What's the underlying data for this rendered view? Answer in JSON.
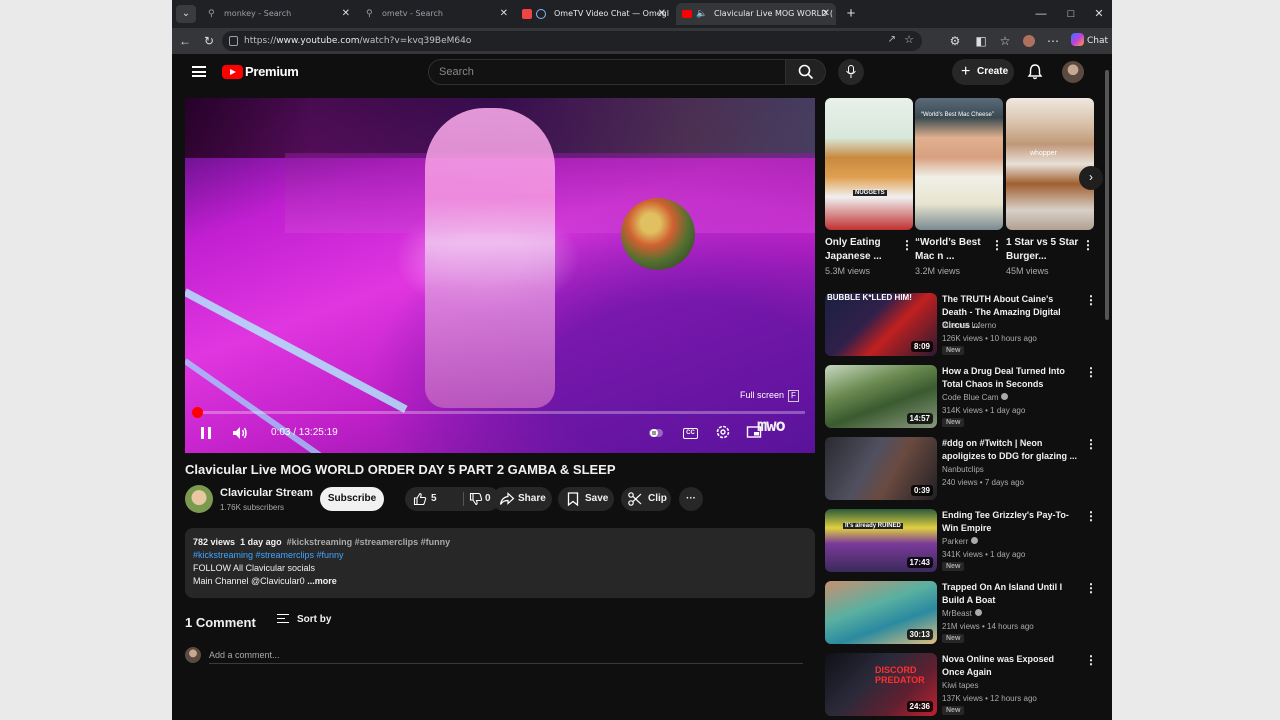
{
  "browser": {
    "tabs": [
      {
        "label": "monkey - Search",
        "active": false
      },
      {
        "label": "ometv - Search",
        "active": false
      },
      {
        "label": "OmeTV Video Chat — Omegl",
        "active": false
      },
      {
        "label": "Clavicular Live MOG WORLD (",
        "active": true
      }
    ],
    "url_prefix": "https://",
    "url_host": "www.youtube.com",
    "url_path": "/watch?v=kvq39BeM64o",
    "chat_label": "Chat"
  },
  "header": {
    "logo_text": "Premium",
    "search_placeholder": "Search",
    "create_label": "Create"
  },
  "player": {
    "time": "0:03 / 13:25:19",
    "progress": 0.0004,
    "fullscreen_tip": "Full screen",
    "fullscreen_key": "F",
    "watermark": "mwo"
  },
  "video": {
    "title": "Clavicular Live MOG WORLD ORDER DAY 5 PART 2 GAMBA & SLEEP",
    "channel": "Clavicular Stream",
    "subscribers": "1.76K subscribers",
    "subscribe_label": "Subscribe",
    "likes": "5",
    "dislikes": "0",
    "share_label": "Share",
    "save_label": "Save",
    "clip_label": "Clip"
  },
  "description": {
    "views": "782 views",
    "age": "1 day ago",
    "tags_line1": "#kickstreaming #streamerclips #funny",
    "tags_line2": "#kickstreaming #streamerclips #funny",
    "line3": "FOLLOW All Clavicular socials",
    "line4": "Main Channel @Clavicular0",
    "more": "...more"
  },
  "comments": {
    "count_label": "1 Comment",
    "sort_label": "Sort by",
    "add_placeholder": "Add a comment..."
  },
  "shorts": [
    {
      "title": "Only Eating Japanese ...",
      "views": "5.3M views",
      "overlay": "NUGGETS"
    },
    {
      "title": "“World’s Best Mac n ...",
      "views": "3.2M views",
      "overlay": "“World’s Best Mac Cheese”"
    },
    {
      "title": "1 Star vs 5 Star Burger...",
      "views": "45M views",
      "overlay": "whopper"
    }
  ],
  "related": [
    {
      "title": "The TRUTH About Caine's Death - The Amazing Digital Circus ...",
      "channel": "Internet Inferno",
      "meta": "126K views • 10 hours ago",
      "badge": "New",
      "duration": "8:09",
      "thumb_text": "BUBBLE K*LLED HIM!",
      "verified": false
    },
    {
      "title": "How a Drug Deal Turned Into Total Chaos in Seconds",
      "channel": "Code Blue Cam",
      "meta": "314K views • 1 day ago",
      "badge": "New",
      "duration": "14:57",
      "thumb_text": "",
      "verified": true
    },
    {
      "title": "#ddg on #Twitch | Neon apoligizes to DDG for glazing ...",
      "channel": "Nanbutclips",
      "meta": "240 views • 7 days ago",
      "badge": "",
      "duration": "0:39",
      "thumb_text": "",
      "verified": false
    },
    {
      "title": "Ending Tee Grizzley's Pay-To-Win Empire",
      "channel": "Parkerr",
      "meta": "341K views • 1 day ago",
      "badge": "New",
      "duration": "17:43",
      "thumb_text": "It's already RUINED",
      "verified": true
    },
    {
      "title": "Trapped On An Island Until I Build A Boat",
      "channel": "MrBeast",
      "meta": "21M views • 14 hours ago",
      "badge": "New",
      "duration": "30:13",
      "thumb_text": "",
      "verified": true
    },
    {
      "title": "Nova Online was Exposed Once Again",
      "channel": "Kiwi tapes",
      "meta": "137K views • 12 hours ago",
      "badge": "New",
      "duration": "24:36",
      "thumb_text": "DISCORD PREDATOR",
      "verified": false
    }
  ],
  "colors": {
    "accent": "#ff0000",
    "link": "#3ea6ff",
    "bg": "#0f0f0f",
    "surface": "#272727"
  }
}
